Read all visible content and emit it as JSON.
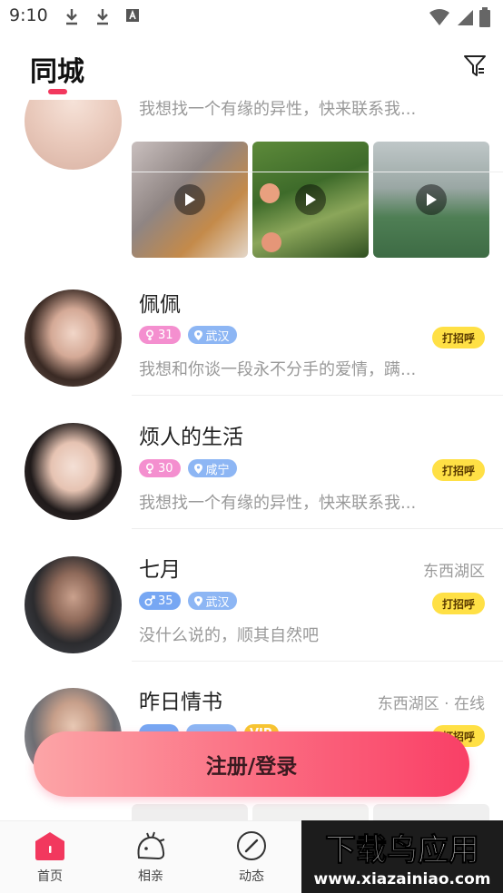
{
  "status_bar": {
    "time": "9:10"
  },
  "header": {
    "title": "同城"
  },
  "feed": {
    "partial_card": {
      "bio": "我想找一个有缘的异性，快来联系我..."
    },
    "users": [
      {
        "name": "佩佩",
        "age": "31",
        "city": "武汉",
        "bio": "我想和你谈一段永不分手的爱情，蹒...",
        "greet": "打招呼",
        "location": ""
      },
      {
        "name": "烦人的生活",
        "age": "30",
        "city": "咸宁",
        "bio": "我想找一个有缘的异性，快来联系我...",
        "greet": "打招呼",
        "location": ""
      },
      {
        "name": "七月",
        "age": "35",
        "city": "武汉",
        "bio": "没什么说的，顺其自然吧",
        "greet": "打招呼",
        "location": "东西湖区"
      },
      {
        "name": "昨日情书",
        "age": "",
        "city": "",
        "vip": "VIP",
        "bio": "",
        "greet": "打招呼",
        "location": "东西湖区 · 在线"
      }
    ]
  },
  "register_button": {
    "label": "注册/登录"
  },
  "bottom_nav": {
    "items": [
      {
        "label": "首页",
        "icon": "home-icon"
      },
      {
        "label": "相亲",
        "icon": "dating-icon"
      },
      {
        "label": "动态",
        "icon": "moments-icon"
      }
    ]
  },
  "watermark": {
    "text": "下载鸟应用",
    "url_text": "www.xiazainiao.com"
  },
  "colors": {
    "accent": "#f2385e",
    "greet_bg": "#ffe045",
    "tag_female": "#f48fcf",
    "tag_male": "#77a7f3",
    "tag_city": "#8db6f4"
  }
}
